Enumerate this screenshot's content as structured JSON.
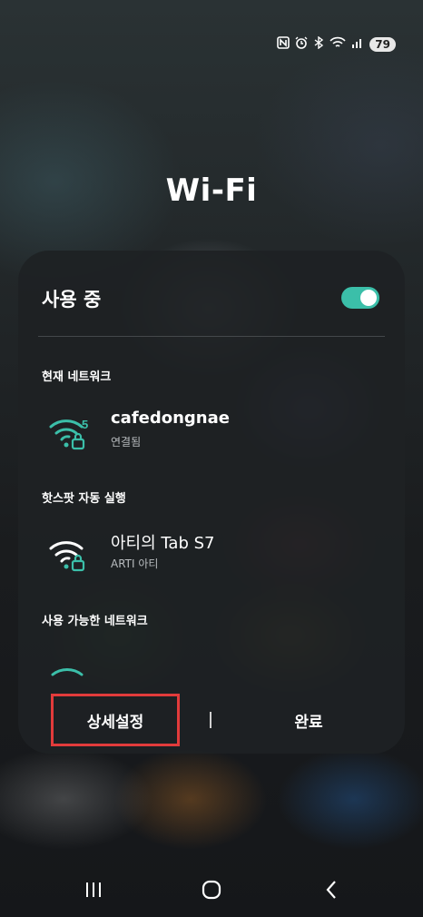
{
  "status_bar": {
    "icons": [
      "nfc-icon",
      "alarm-icon",
      "bluetooth-icon",
      "wifi-icon",
      "signal-icon"
    ],
    "battery": "79"
  },
  "title": "Wi-Fi",
  "panel": {
    "in_use_label": "사용 중",
    "toggle_on": true,
    "accent_color": "#3bbfa9",
    "current_network_heading": "현재 네트워크",
    "current_network": {
      "name": "cafedongnae",
      "status": "연결됨",
      "badge": "5",
      "icon": "wifi-lock-icon"
    },
    "hotspot_heading": "핫스팟 자동 실행",
    "hotspot_network": {
      "name": "아티의 Tab S7",
      "sub": "ARTI 아티",
      "icon": "wifi-lock-icon"
    },
    "available_heading": "사용 가능한 네트워크"
  },
  "buttons": {
    "details": "상세설정",
    "done": "완료"
  },
  "navbar": {
    "recents": "recents-icon",
    "home": "home-icon",
    "back": "back-icon"
  }
}
